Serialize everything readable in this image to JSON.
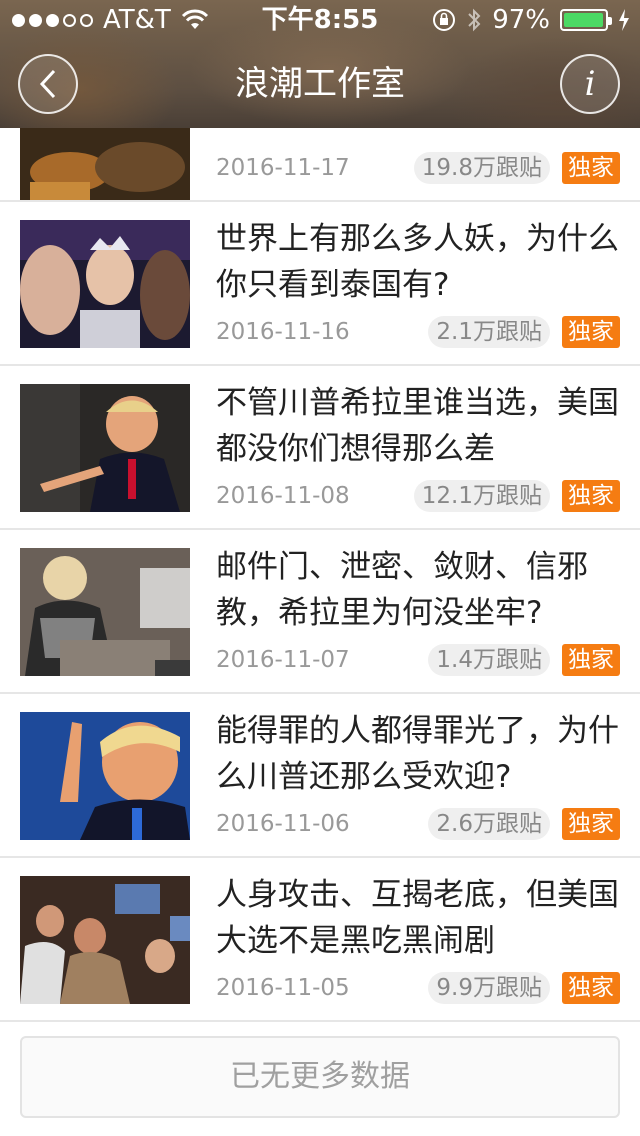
{
  "status_bar": {
    "carrier": "AT&T",
    "time": "下午8:55",
    "battery": "97%",
    "battery_level": 0.97,
    "signal_bars": 3,
    "icons": [
      "signal-dots-icon",
      "wifi-icon",
      "orientation-lock-icon",
      "bluetooth-icon",
      "battery-icon",
      "charging-bolt-icon"
    ]
  },
  "nav": {
    "title": "浪潮工作室",
    "back_icon": "chevron-left-icon",
    "info_label": "i"
  },
  "articles": [
    {
      "title": "",
      "date": "2016-11-17",
      "replies": "19.8万跟贴",
      "badge": "独家",
      "thumb": "dark-brown-photo"
    },
    {
      "title": "世界上有那么多人妖，为什么你只看到泰国有?",
      "date": "2016-11-16",
      "replies": "2.1万跟贴",
      "badge": "独家",
      "thumb": "pageant-photo"
    },
    {
      "title": "不管川普希拉里谁当选，美国都没你们想得那么差",
      "date": "2016-11-08",
      "replies": "12.1万跟贴",
      "badge": "独家",
      "thumb": "speaker-pointing-photo"
    },
    {
      "title": "邮件门、泄密、敛财、信邪教，希拉里为何没坐牢?",
      "date": "2016-11-07",
      "replies": "1.4万跟贴",
      "badge": "独家",
      "thumb": "desk-meeting-photo"
    },
    {
      "title": "能得罪的人都得罪光了，为什么川普还那么受欢迎?",
      "date": "2016-11-06",
      "replies": "2.6万跟贴",
      "badge": "独家",
      "thumb": "speaker-blue-bg-photo"
    },
    {
      "title": "人身攻击、互揭老底，但美国大选不是黑吃黑闹剧",
      "date": "2016-11-05",
      "replies": "9.9万跟贴",
      "badge": "独家",
      "thumb": "bar-crowd-photo"
    }
  ],
  "footer": {
    "label": "已无更多数据"
  },
  "colors": {
    "badge": "#f57c12",
    "battery": "#4cd964",
    "divider": "#e6e6e6"
  }
}
